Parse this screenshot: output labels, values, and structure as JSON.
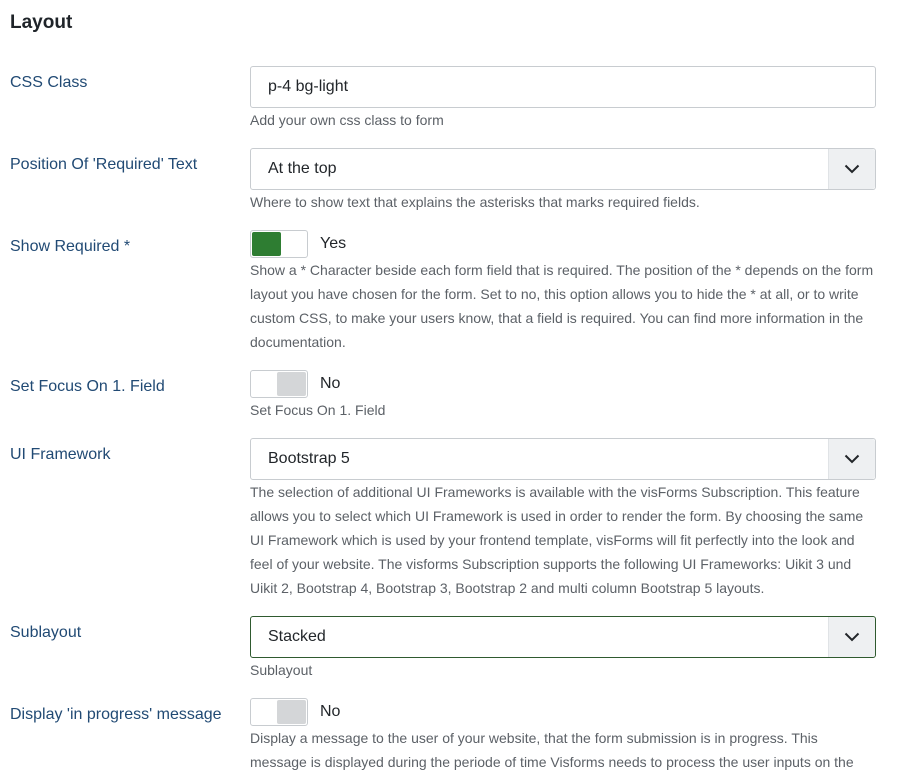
{
  "section_title": "Layout",
  "css_class": {
    "label": "CSS Class",
    "value": "p-4 bg-light",
    "help": "Add your own css class to form"
  },
  "required_position": {
    "label": "Position Of 'Required' Text",
    "value": "At the top",
    "help": "Where to show text that explains the asterisks that marks required fields."
  },
  "show_required": {
    "label": "Show Required *",
    "state": "Yes",
    "help": "Show a * Character beside each form field that is required. The position of the * depends on the form layout you have chosen for the form. Set to no, this option allows you to hide the * at all, or to write custom CSS, to make your users know, that a field is required. You can find more information in the documentation."
  },
  "set_focus": {
    "label": "Set Focus On 1. Field",
    "state": "No",
    "help": "Set Focus On 1. Field"
  },
  "ui_framework": {
    "label": "UI Framework",
    "value": "Bootstrap 5",
    "help": "The selection of additional UI Frameworks is available with the visForms Subscription. This feature allows you to select which UI Framework is used in order to render the form. By choosing the same UI Framework which is used by your frontend template, visForms will fit perfectly into the look and feel of your website. The visforms Subscription supports the following UI Frameworks: Uikit 3 und Uikit 2, Bootstrap 4, Bootstrap 3, Bootstrap 2 and multi column Bootstrap 5 layouts."
  },
  "sublayout": {
    "label": "Sublayout",
    "value": "Stacked",
    "help": "Sublayout"
  },
  "in_progress": {
    "label": "Display 'in progress' message",
    "state": "No",
    "help": "Display a message to the user of your website, that the form submission is in progress. This message is displayed during the periode of time Visforms needs to process the user inputs on the"
  },
  "colors": {
    "label": "#214a74",
    "toggle_on": "#2e7d32",
    "toggle_off": "#d4d6d8",
    "help_text": "#5c6167"
  },
  "icons": {
    "select_caret": "chevron-down-icon"
  }
}
